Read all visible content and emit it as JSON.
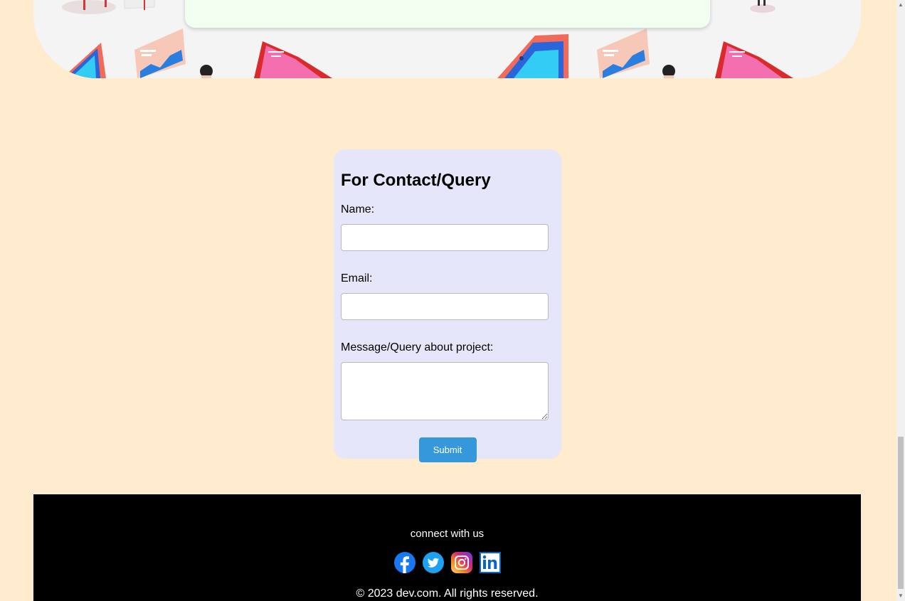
{
  "contact": {
    "title": "For Contact/Query",
    "name_label": "Name:",
    "name_value": "",
    "email_label": "Email:",
    "email_value": "",
    "message_label": "Message/Query about project:",
    "message_value": "",
    "submit_label": "Submit"
  },
  "footer": {
    "connect_text": "connect with us",
    "socials": [
      {
        "name": "facebook",
        "icon": "facebook-icon"
      },
      {
        "name": "twitter",
        "icon": "twitter-icon"
      },
      {
        "name": "instagram",
        "icon": "instagram-icon"
      },
      {
        "name": "linkedin",
        "icon": "linkedin-icon"
      }
    ],
    "copyright": "© 2023 dev.com. All rights reserved."
  },
  "colors": {
    "page_background": "#ffebcd",
    "form_background": "#e6e6fa",
    "submit_button": "#3498db",
    "footer_background": "#000000"
  }
}
